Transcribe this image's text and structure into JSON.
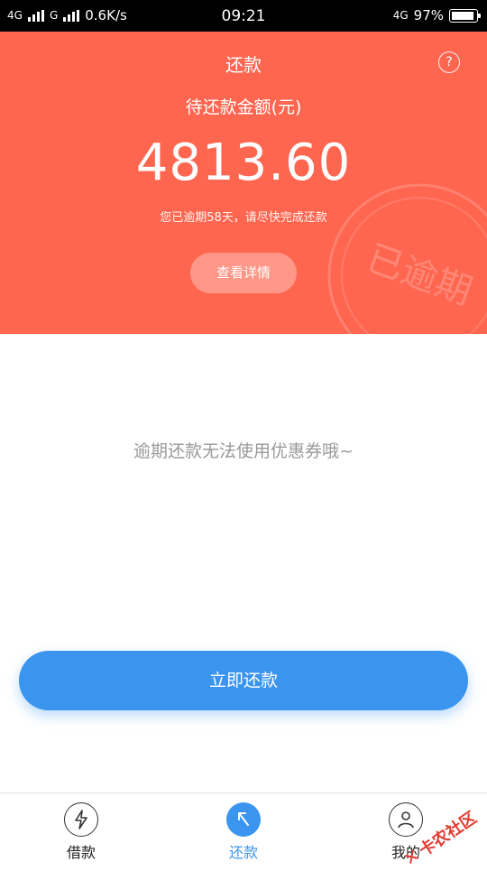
{
  "status_bar": {
    "net1": "4G",
    "net2": "G",
    "speed": "0.6K/s",
    "time": "09:21",
    "net3": "4G",
    "battery": "97%",
    "battery_level": 0.97
  },
  "header": {
    "title": "还款",
    "help_symbol": "?",
    "amount_label": "待还款金额(元)",
    "amount": "4813.60",
    "overdue_note": "您已逾期58天，请尽快完成还款",
    "details_button": "查看详情",
    "stamp_text": "已逾期",
    "bg_color": "#ff6650"
  },
  "main": {
    "coupon_message": "逾期还款无法使用优惠券哦~"
  },
  "actions": {
    "repay_button": "立即还款",
    "accent_color": "#3b95ef"
  },
  "tabbar": {
    "tabs": [
      {
        "label": "借款",
        "icon": "lightning-icon",
        "active": false
      },
      {
        "label": "还款",
        "icon": "return-arrow-icon",
        "active": true
      },
      {
        "label": "我的",
        "icon": "user-icon",
        "active": false
      }
    ]
  },
  "watermark": {
    "text": "卡农社区"
  }
}
